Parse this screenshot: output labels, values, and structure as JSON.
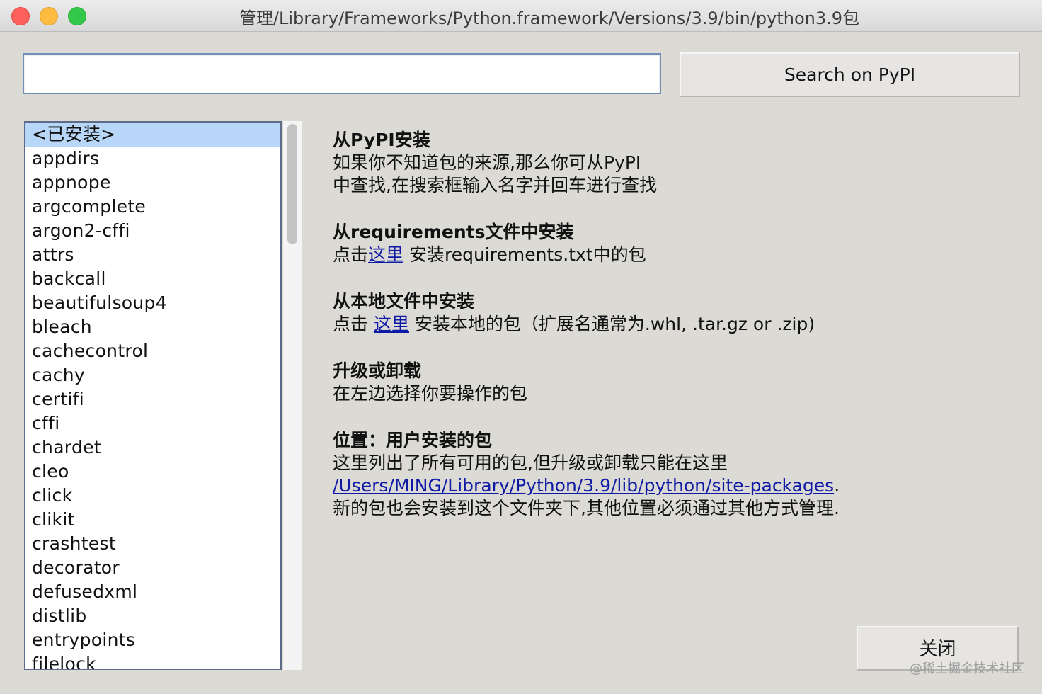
{
  "window": {
    "title": "管理/Library/Frameworks/Python.framework/Versions/3.9/bin/python3.9包"
  },
  "search": {
    "value": "",
    "button_label": "Search on PyPI"
  },
  "packages": [
    "<已安装>",
    "appdirs",
    "appnope",
    "argcomplete",
    "argon2-cffi",
    "attrs",
    "backcall",
    "beautifulsoup4",
    "bleach",
    "cachecontrol",
    "cachy",
    "certifi",
    "cffi",
    "chardet",
    "cleo",
    "click",
    "clikit",
    "crashtest",
    "decorator",
    "defusedxml",
    "distlib",
    "entrypoints",
    "filelock"
  ],
  "selected_package": "<已安装>",
  "info": {
    "pypi": {
      "heading": "从PyPI安装",
      "line1": "如果你不知道包的来源,那么你可从PyPI",
      "line2": "中查找,在搜索框输入名字并回车进行查找"
    },
    "requirements": {
      "heading": "从requirements文件中安装",
      "prefix": "点击",
      "link": "这里",
      "suffix": " 安装requirements.txt中的包"
    },
    "local": {
      "heading": "从本地文件中安装",
      "prefix": "点击 ",
      "link": "这里",
      "suffix": " 安装本地的包（扩展名通常为.whl, .tar.gz or .zip)"
    },
    "upgrade": {
      "heading": "升级或卸载",
      "line1": "在左边选择你要操作的包"
    },
    "location": {
      "heading": "位置：用户安装的包",
      "line1": "这里列出了所有可用的包,但升级或卸载只能在这里",
      "path_link": "/Users/MING/Library/Python/3.9/lib/python/site-packages",
      "path_suffix": ".",
      "line3": "新的包也会安装到这个文件夹下,其他位置必须通过其他方式管理."
    }
  },
  "footer": {
    "close_label": "关闭",
    "watermark": "@稀土掘金技术社区"
  }
}
